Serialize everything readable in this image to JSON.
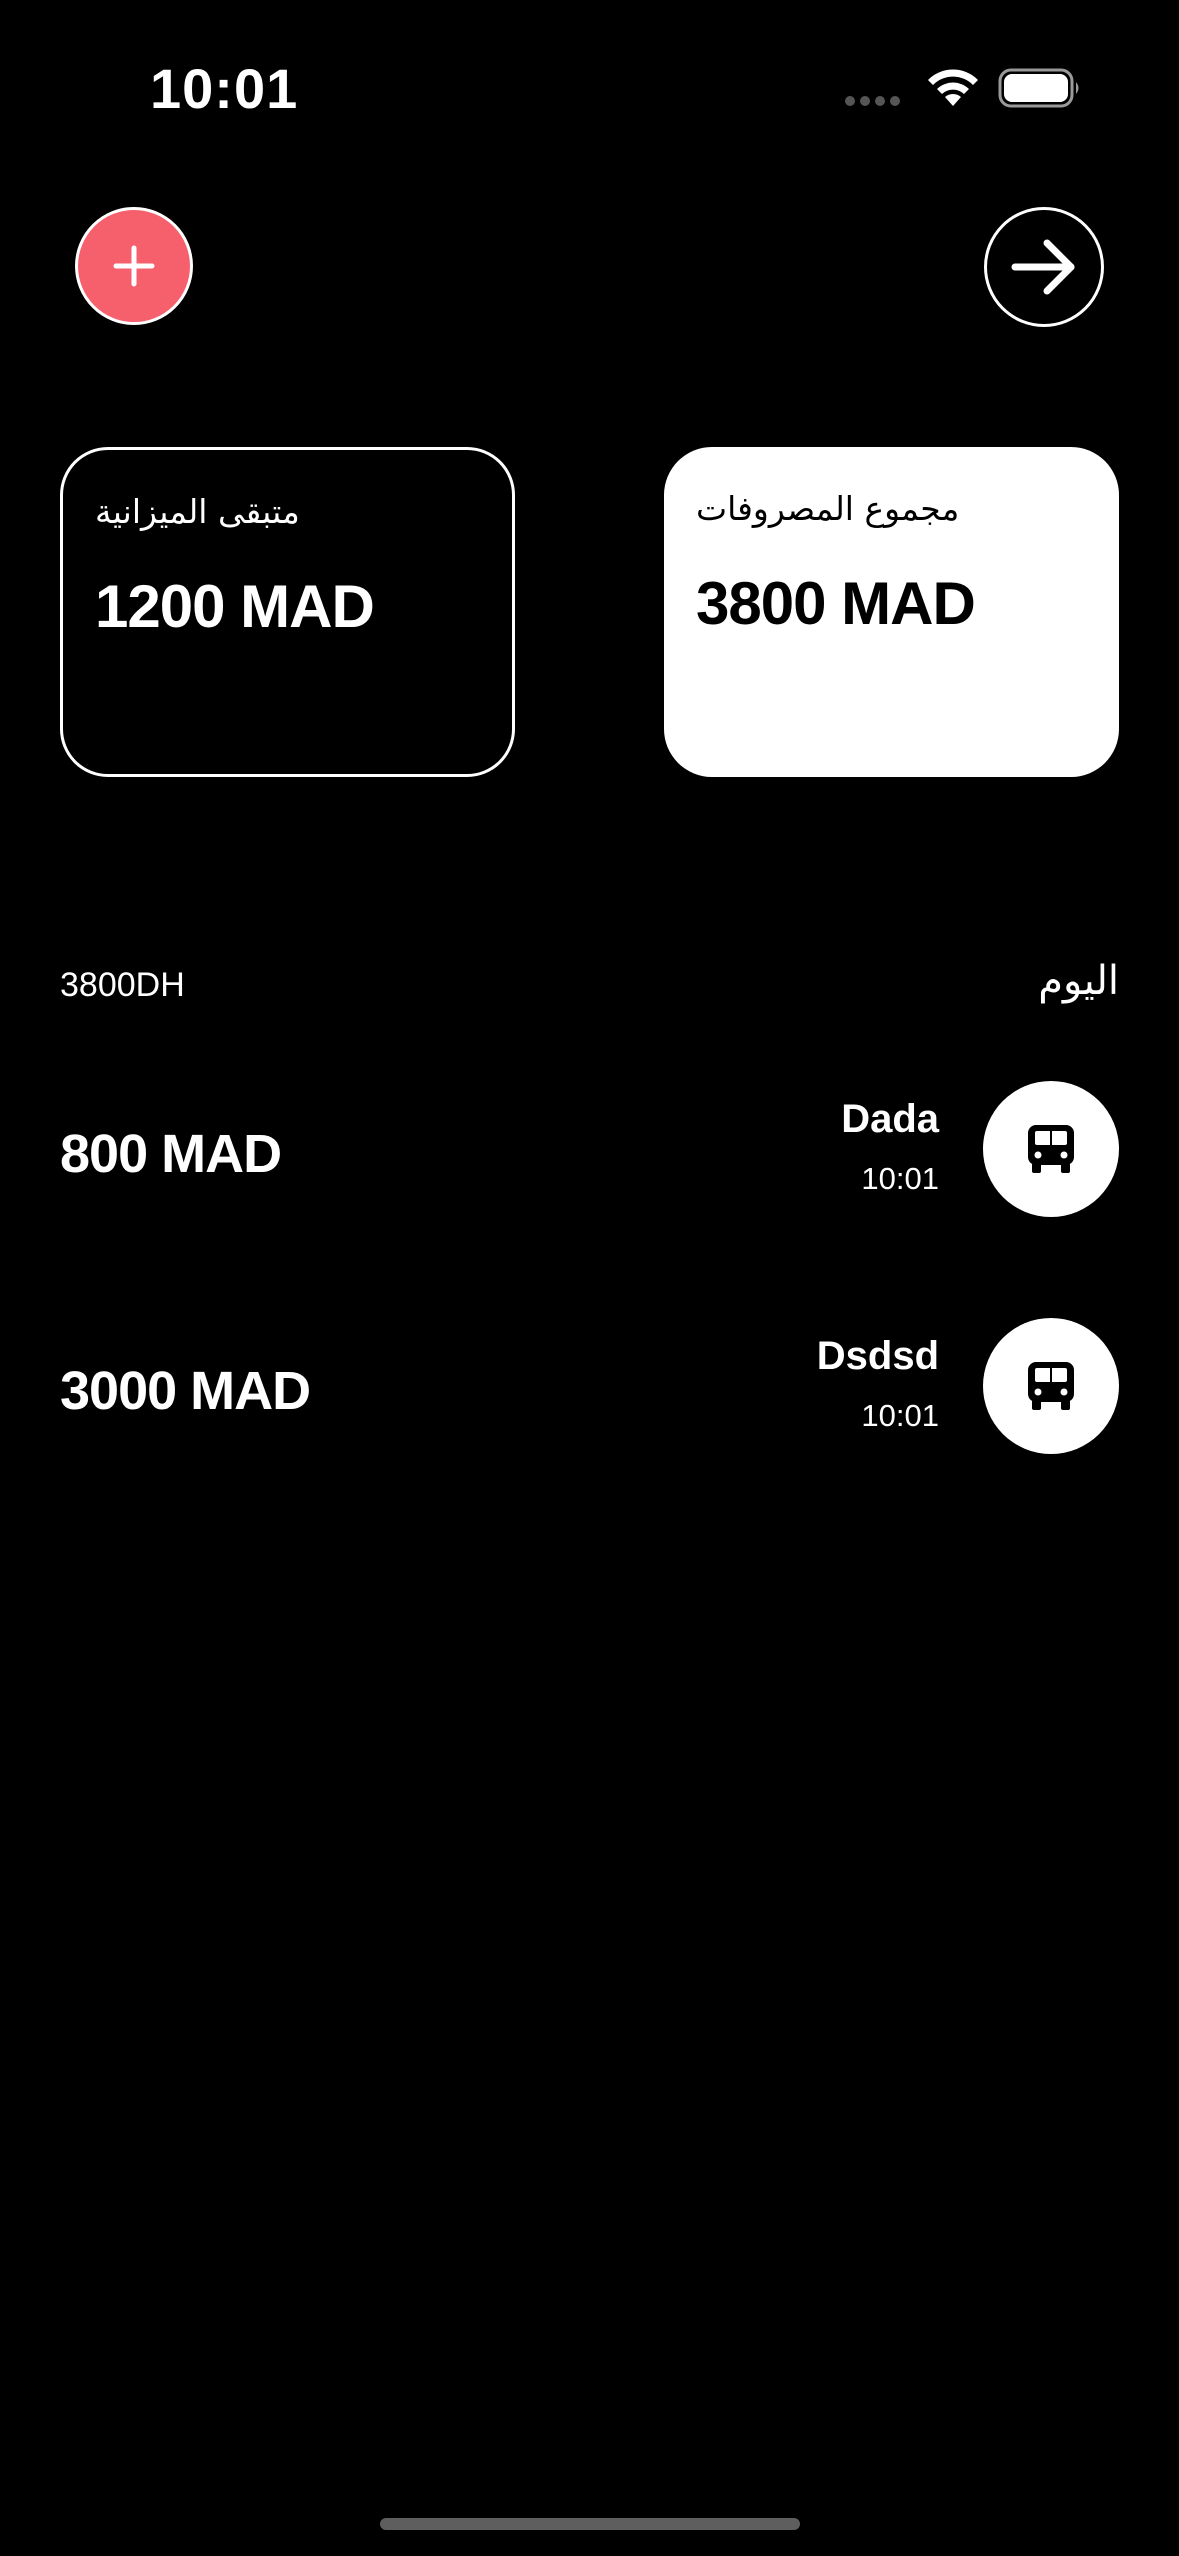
{
  "status_bar": {
    "time": "10:01"
  },
  "actions": {
    "add_icon": "plus-icon",
    "next_icon": "arrow-right-icon",
    "add_color": "#f6606d"
  },
  "cards": {
    "remaining": {
      "label": "متبقى الميزانية",
      "amount": "1200 MAD"
    },
    "total": {
      "label": "مجموع المصروفات",
      "amount": "3800 MAD"
    }
  },
  "day": {
    "title": "اليوم",
    "total": "3800DH"
  },
  "expenses": [
    {
      "name": "Dada",
      "time": "10:01",
      "amount": "800 MAD",
      "icon": "bus-icon"
    },
    {
      "name": "Dsdsd",
      "time": "10:01",
      "amount": "3000 MAD",
      "icon": "bus-icon"
    }
  ]
}
